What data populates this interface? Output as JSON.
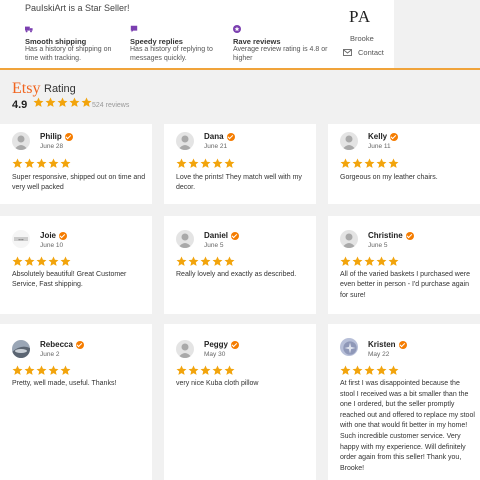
{
  "seller": {
    "title": "PauIskiArt is a Star Seller!",
    "features": [
      {
        "title": "Smooth shipping",
        "desc": "Has a history of shipping on time with tracking.",
        "icon": "shipping-truck-icon"
      },
      {
        "title": "Speedy replies",
        "desc": "Has a history of replying to messages quickly.",
        "icon": "chat-bubble-icon"
      },
      {
        "title": "Rave reviews",
        "desc": "Average review rating is 4.8 or higher",
        "icon": "star-badge-icon"
      }
    ],
    "logo": "PA",
    "owner": "Brooke",
    "contact_label": "Contact"
  },
  "rating": {
    "brand": "Etsy",
    "label": "Rating",
    "value": "4.9",
    "stars": 5,
    "count": "524 reviews"
  },
  "colors": {
    "star": "#f2a40c",
    "brand": "#f1641e",
    "verified": "#f57c00",
    "feature_icon": "#7b3fb0",
    "divider": "#f0a33a"
  },
  "reviews": [
    {
      "name": "Philip",
      "date": "June 28",
      "stars": 5,
      "text": "Super responsive, shipped out on time and very well packed"
    },
    {
      "name": "Dana",
      "date": "June 21",
      "stars": 5,
      "text": "Love the prints! They match well with my decor."
    },
    {
      "name": "Kelly",
      "date": "June 11",
      "stars": 5,
      "text": "Gorgeous on my leather chairs."
    },
    {
      "name": "Joie",
      "date": "June 10",
      "stars": 5,
      "text": "Absolutely beautiful! Great Customer Service, Fast shipping."
    },
    {
      "name": "Daniel",
      "date": "June 5",
      "stars": 5,
      "text": "Really lovely and exactly as described."
    },
    {
      "name": "Christine",
      "date": "June 5",
      "stars": 5,
      "text": "All of the varied baskets I purchased were even better in person - I'd purchase again for sure!"
    },
    {
      "name": "Rebecca",
      "date": "June 2",
      "stars": 5,
      "text": "Pretty, well made, useful. Thanks!"
    },
    {
      "name": "Peggy",
      "date": "May 30",
      "stars": 5,
      "text": "very nice Kuba cloth pillow"
    },
    {
      "name": "Kristen",
      "date": "May 22",
      "stars": 5,
      "text": "At first I was disappointed because the stool I received was a bit smaller than the one I ordered, but the seller promptly reached out and offered to replace my stool with one that would fit better in my home! Such incredible customer service. Very happy with my experience. Will definitely order again from this seller! Thank you, Brooke!"
    }
  ]
}
